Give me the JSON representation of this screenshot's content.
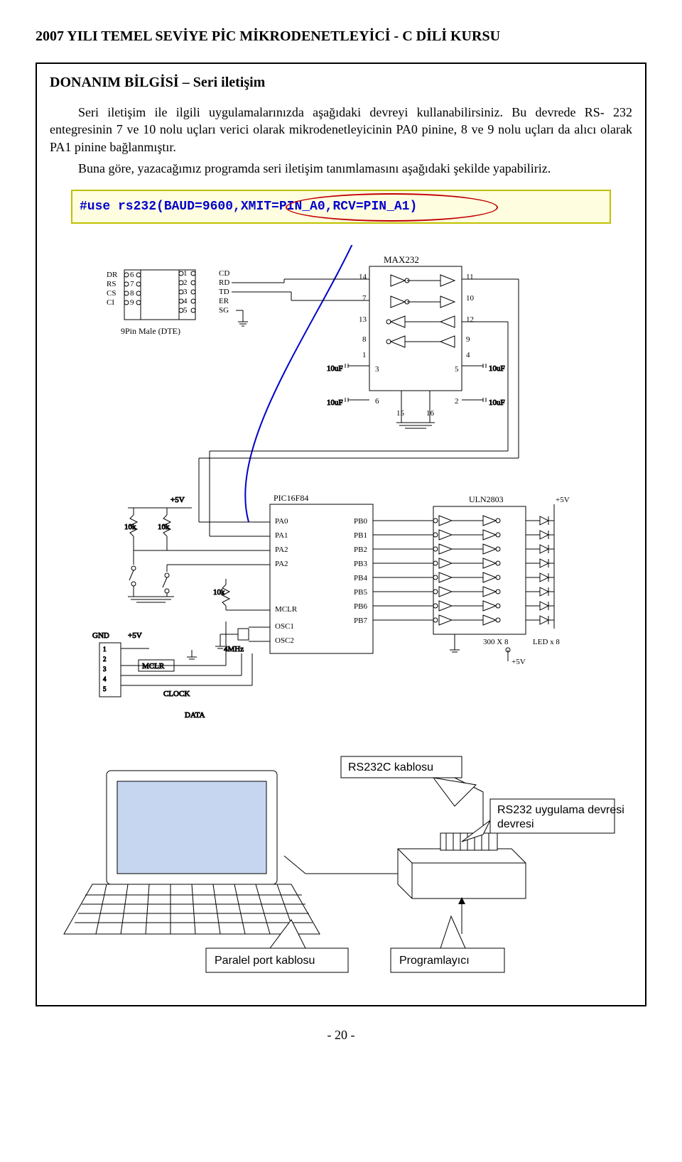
{
  "header": "2007 YILI TEMEL SEVİYE PİC MİKRODENETLEYİCİ -  C DİLİ KURSU",
  "box": {
    "title": "DONANIM BİLGİSİ – Seri iletişim",
    "para": "Seri iletişim ile ilgili uygulamalarınızda aşağıdaki devreyi kullanabilirsiniz. Bu devrede RS- 232 entegresinin 7 ve 10 nolu uçları verici olarak mikrodenetleyicinin PA0 pinine, 8 ve 9 nolu uçları da alıcı olarak PA1 pinine bağlanmıştır.",
    "para2": "Buna göre, yazacağımız programda seri iletişim tanımlamasını aşağıdaki şekilde yapabiliriz.",
    "code": "#use rs232(BAUD=9600,XMIT=PIN_A0,RCV=PIN_A1)"
  },
  "diagram": {
    "max232": {
      "label": "MAX232",
      "pins_left": [
        "14",
        "7",
        "13",
        "8",
        "1",
        "3",
        "6",
        "15"
      ],
      "pins_right": [
        "11",
        "10",
        "12",
        "9",
        "4",
        "5",
        "2",
        "16"
      ],
      "caps": "10uF"
    },
    "dte": {
      "label": "9Pin Male (DTE)",
      "left_pins": [
        "DR",
        "RS",
        "CS",
        "CI"
      ],
      "left_nums": [
        "6",
        "7",
        "8",
        "9"
      ],
      "right_nums": [
        "1",
        "2",
        "3",
        "4",
        "5"
      ],
      "right_pins": [
        "CD",
        "RD",
        "TD",
        "ER",
        "SG"
      ]
    },
    "pic": {
      "label": "PIC16F84",
      "left": [
        "PA0",
        "PA1",
        "PA2",
        "PA2",
        "",
        "",
        "MCLR",
        "OSC1",
        "OSC2"
      ],
      "right": [
        "PB0",
        "PB1",
        "PB2",
        "PB3",
        "PB4",
        "PB5",
        "PB6",
        "PB7"
      ]
    },
    "uln": {
      "label": "ULN2803",
      "res": "300 X 8",
      "led": "LED x 8"
    },
    "volt5": "+5V",
    "r10k": "10k",
    "gnd": "GND",
    "mclr": "MCLR",
    "clock_freq": "4MHz",
    "clock": "CLOCK",
    "data": "DATA",
    "callouts": {
      "rs232c_cable": "RS232C kablosu",
      "rs232_app": "RS232 uygulama devresi",
      "parallel_cable": "Paralel port kablosu",
      "programmer": "Programlayıcı"
    }
  },
  "page_num": "- 20 -"
}
